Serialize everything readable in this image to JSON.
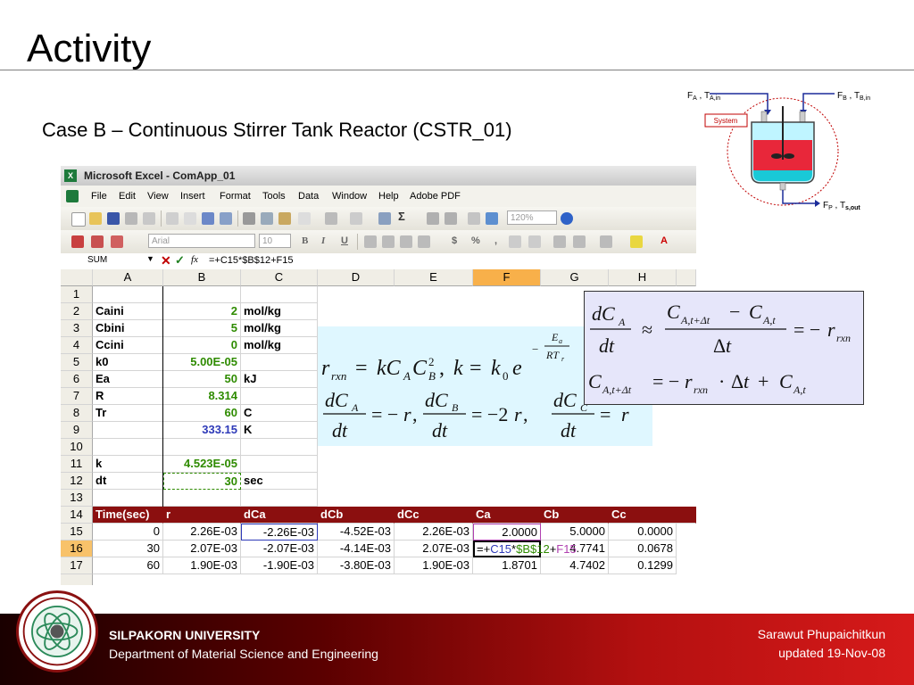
{
  "slide": {
    "title": "Activity",
    "subtitle": "Case B – Continuous Stirrer Tank Reactor (CSTR_01)"
  },
  "diagram": {
    "inlet_a": "Fₐ , Tₐ,ᵢₙ",
    "inlet_a_main": "F",
    "inlet_a_sub1": "A",
    "inlet_a_t": "T",
    "inlet_a_sub2": "A,in",
    "inlet_b_main": "F",
    "inlet_b_sub1": "B",
    "inlet_b_t": "T",
    "inlet_b_sub2": "B,in",
    "outlet_main": "F",
    "outlet_sub1": "P",
    "outlet_t": "T",
    "outlet_sub2": "s,out",
    "system_label": "System"
  },
  "excel": {
    "window_title": "Microsoft Excel - ComApp_01",
    "menu": [
      "File",
      "Edit",
      "View",
      "Insert",
      "Format",
      "Tools",
      "Data",
      "Window",
      "Help",
      "Adobe PDF"
    ],
    "zoom": "120%",
    "font_name": "Arial",
    "font_size": "10",
    "name_box": "SUM",
    "formula": "=+C15*$B$12+F15",
    "columns": [
      "A",
      "B",
      "C",
      "D",
      "E",
      "F",
      "G",
      "H"
    ],
    "rows": [
      {
        "n": "1",
        "A": "",
        "B": "",
        "C": ""
      },
      {
        "n": "2",
        "A": "Caini",
        "B": "2",
        "C": "mol/kg"
      },
      {
        "n": "3",
        "A": "Cbini",
        "B": "5",
        "C": "mol/kg"
      },
      {
        "n": "4",
        "A": "Ccini",
        "B": "0",
        "C": "mol/kg"
      },
      {
        "n": "5",
        "A": "k0",
        "B": "5.00E-05",
        "C": ""
      },
      {
        "n": "6",
        "A": "Ea",
        "B": "50",
        "C": "kJ"
      },
      {
        "n": "7",
        "A": "R",
        "B": "8.314",
        "C": ""
      },
      {
        "n": "8",
        "A": "Tr",
        "B": "60",
        "C": "C"
      },
      {
        "n": "9",
        "A": "",
        "B": "333.15",
        "C": "K"
      },
      {
        "n": "10",
        "A": "",
        "B": "",
        "C": ""
      },
      {
        "n": "11",
        "A": "k",
        "B": "4.523E-05",
        "C": ""
      },
      {
        "n": "12",
        "A": "dt",
        "B": "30",
        "C": "sec"
      },
      {
        "n": "13",
        "A": "",
        "B": "",
        "C": ""
      }
    ],
    "table_header": {
      "n": "14",
      "cols": [
        "Time(sec)",
        "r",
        "dCa",
        "dCb",
        "dCc",
        "Ca",
        "Cb",
        "Cc"
      ]
    },
    "table_rows": [
      {
        "n": "15",
        "vals": [
          "0",
          "2.26E-03",
          "-2.26E-03",
          "-4.52E-03",
          "2.26E-03",
          "2.0000",
          "5.0000",
          "0.0000"
        ]
      },
      {
        "n": "16",
        "vals": [
          "30",
          "2.07E-03",
          "-2.07E-03",
          "-4.14E-03",
          "2.07E-03",
          "",
          "4.7741",
          "0.0678"
        ]
      },
      {
        "n": "17",
        "vals": [
          "60",
          "1.90E-03",
          "-1.90E-03",
          "-3.80E-03",
          "1.90E-03",
          "1.8701",
          "4.7402",
          "0.1299"
        ]
      }
    ],
    "edit_formula_parts": [
      "=+",
      "C15",
      "*",
      "$B$12",
      "+",
      "F15"
    ]
  },
  "equations": {
    "rate": "r_rxn = k C_A C_B^2 , k = k_0 e^(-Ea/RTr)",
    "balances": "dC_A/dt = -r , dC_B/dt = -2r , dC_C/dt = r",
    "euler_1": "dC_A/dt ≈ (C_A,t+Δt - C_A,t)/Δt = -r_rxn",
    "euler_2": "C_A,t+Δt = -r_rxn · Δt + C_A,t"
  },
  "footer": {
    "university": "SILPAKORN UNIVERSITY",
    "department": "Department of Material Science and Engineering",
    "author": "Sarawut Phupaichitkun",
    "updated": "updated  19-Nov-08"
  },
  "colors": {
    "footer_red": "#b41010",
    "header_row": "#8b0f0f",
    "value_green": "#2e8b00",
    "value_blue": "#2e3ab8",
    "equation_bg": "#dff7ff",
    "equation2_bg": "#e6e6fa"
  }
}
